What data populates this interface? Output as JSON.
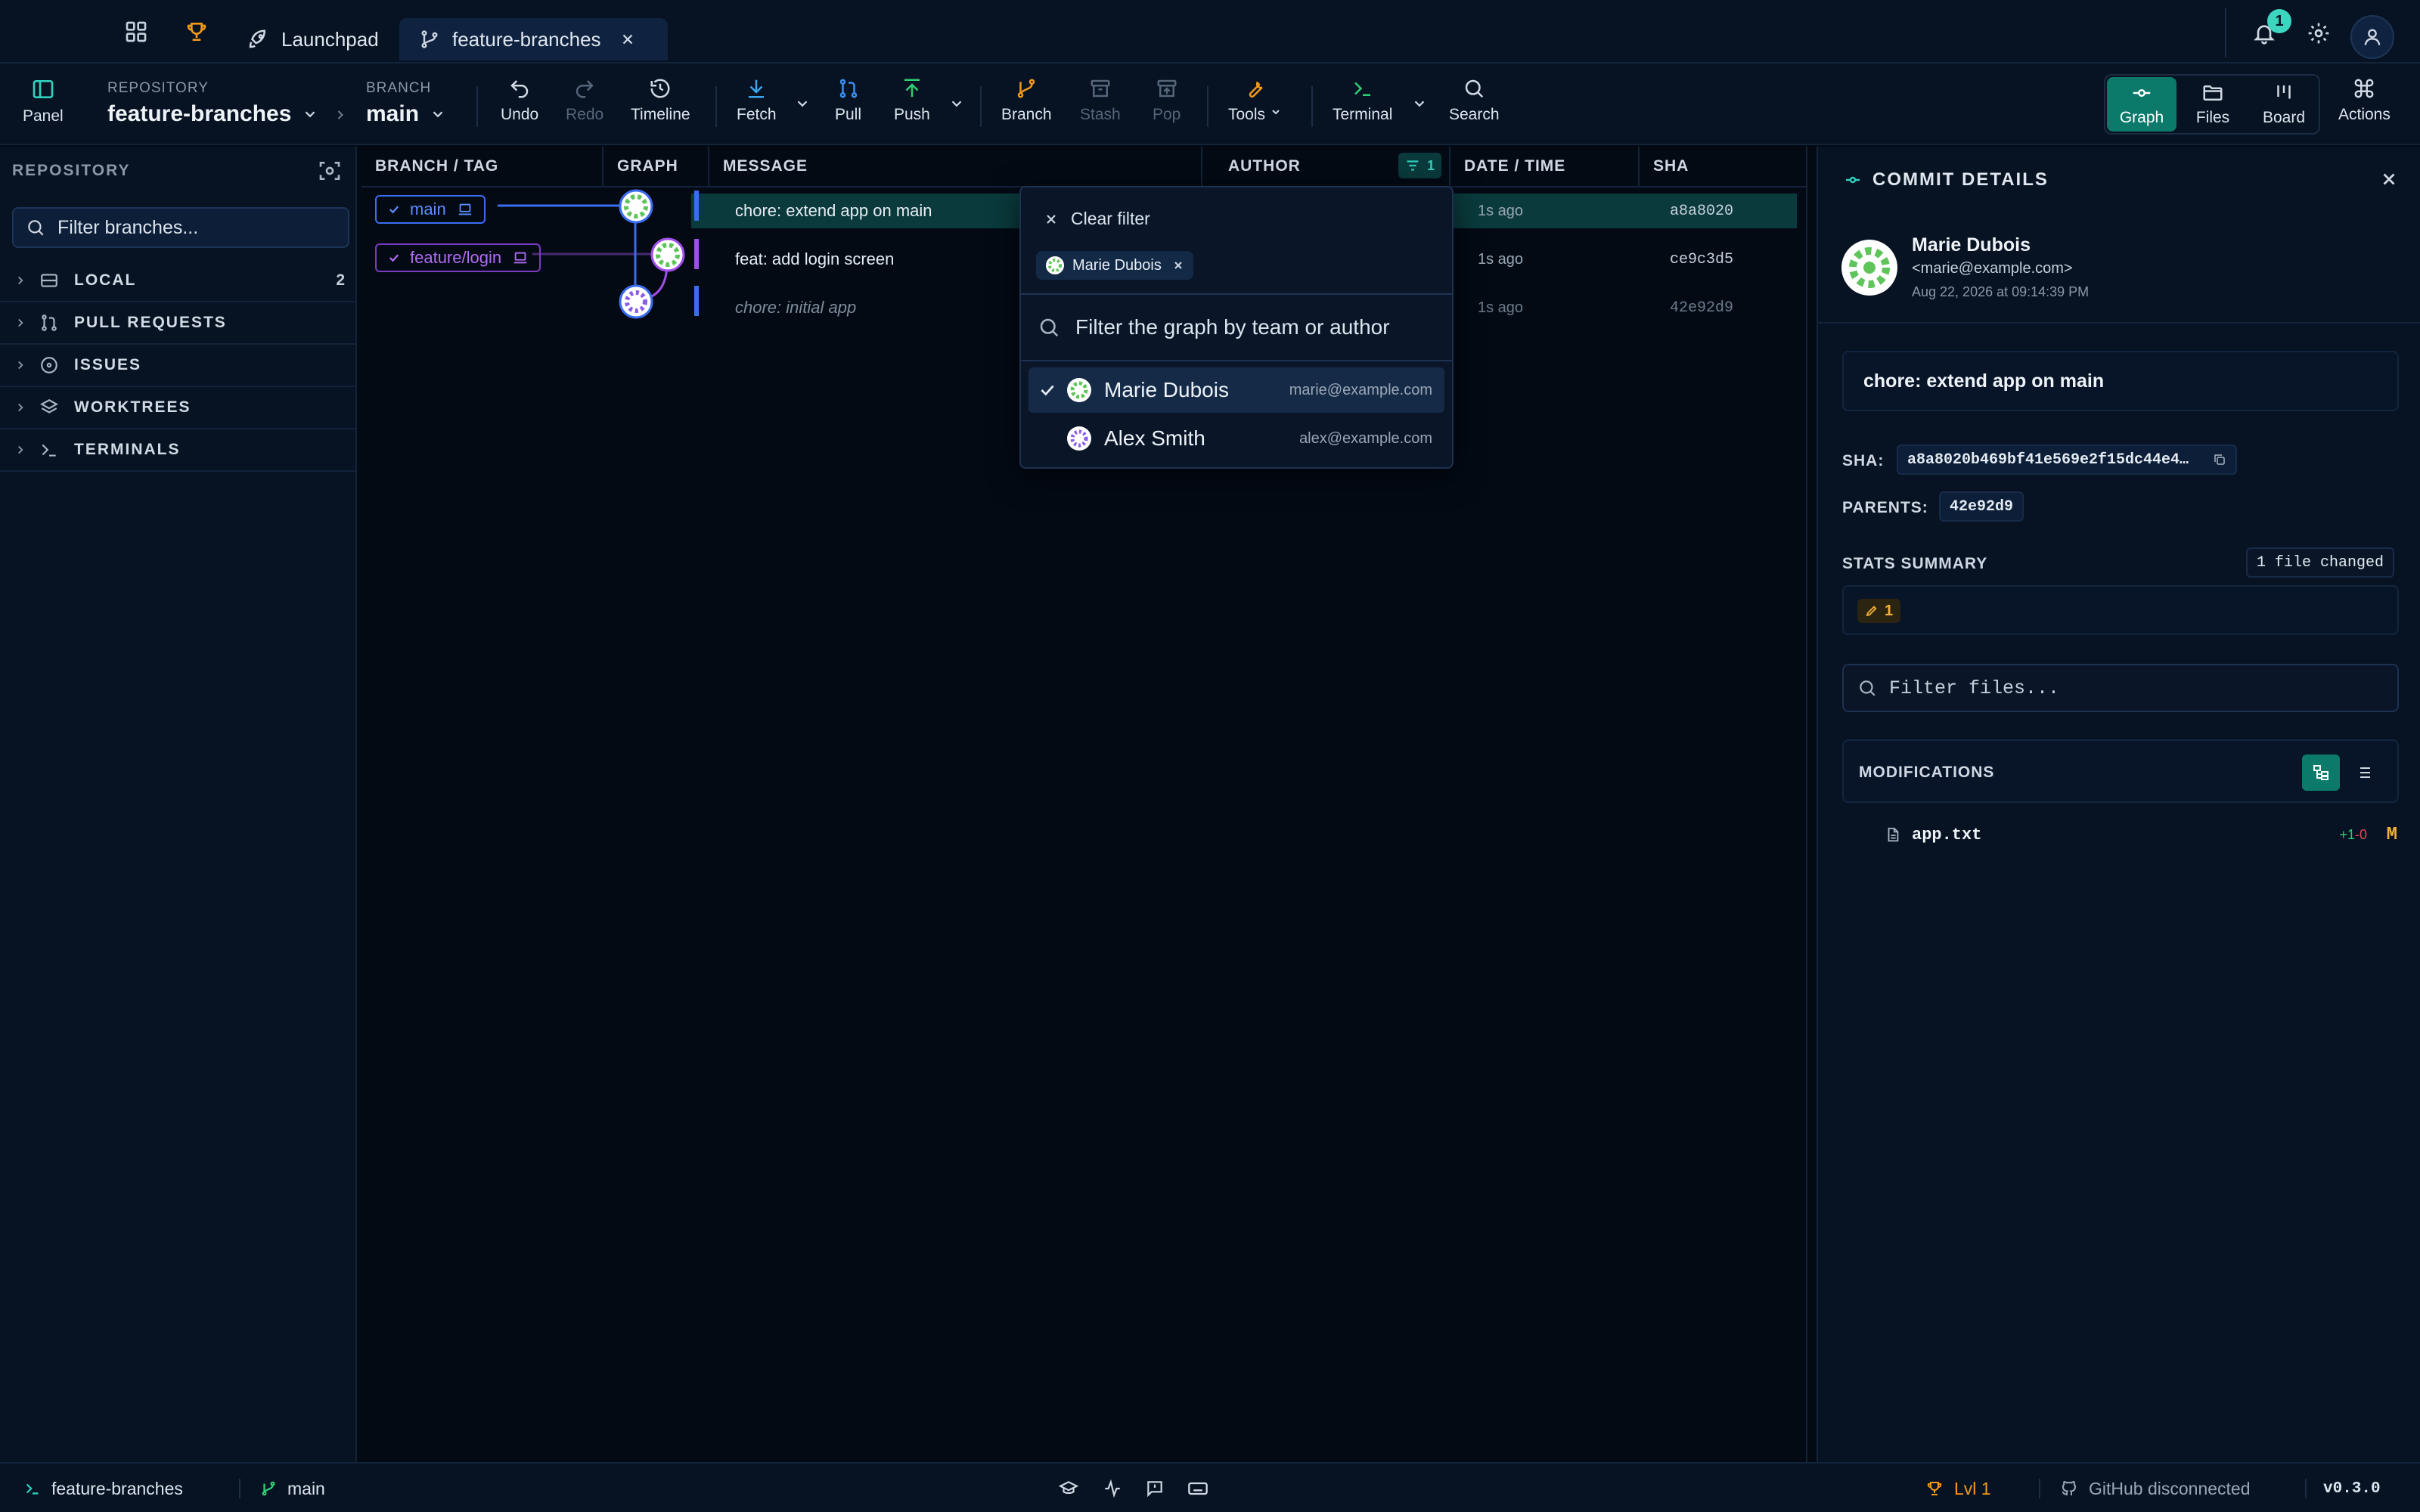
{
  "titlebar": {
    "tabs": [
      {
        "label": "Launchpad",
        "icon": "rocket-icon"
      },
      {
        "label": "feature-branches",
        "icon": "git-branch-icon",
        "active": true
      }
    ],
    "notifications_count": "1"
  },
  "toolbar": {
    "panel_label": "Panel",
    "repository_caption": "REPOSITORY",
    "repository_name": "feature-branches",
    "branch_caption": "BRANCH",
    "branch_name": "main",
    "undo": "Undo",
    "redo": "Redo",
    "timeline": "Timeline",
    "fetch": "Fetch",
    "pull": "Pull",
    "push": "Push",
    "branch": "Branch",
    "stash": "Stash",
    "pop": "Pop",
    "tools": "Tools",
    "terminal": "Terminal",
    "search": "Search",
    "views": {
      "graph": "Graph",
      "files": "Files",
      "board": "Board"
    },
    "actions": "Actions"
  },
  "sidebar": {
    "title": "REPOSITORY",
    "filter_placeholder": "Filter branches...",
    "sections": [
      {
        "label": "LOCAL",
        "icon": "drive-icon",
        "count": "2"
      },
      {
        "label": "PULL REQUESTS",
        "icon": "pull-request-icon",
        "count": ""
      },
      {
        "label": "ISSUES",
        "icon": "issue-icon",
        "count": ""
      },
      {
        "label": "WORKTREES",
        "icon": "layers-icon",
        "count": ""
      },
      {
        "label": "TERMINALS",
        "icon": "terminal-icon",
        "count": ""
      }
    ]
  },
  "graph": {
    "columns": {
      "branch_tag": "BRANCH / TAG",
      "graph": "GRAPH",
      "message": "MESSAGE",
      "author": "AUTHOR",
      "author_filter_count": "1",
      "datetime": "DATE / TIME",
      "sha": "SHA"
    },
    "commits": [
      {
        "branch": "main",
        "message": "chore: extend app on main",
        "date": "1s ago",
        "sha": "a8a8020"
      },
      {
        "branch": "feature/login",
        "message": "feat: add login screen",
        "date": "1s ago",
        "sha": "ce9c3d5"
      },
      {
        "branch": "",
        "message": "chore: initial app",
        "date": "1s ago",
        "sha": "42e92d9"
      }
    ]
  },
  "author_filter": {
    "clear_label": "Clear filter",
    "chip": "Marie Dubois",
    "search_placeholder": "Filter the graph by team or author",
    "authors": [
      {
        "name": "Marie Dubois",
        "email": "marie@example.com",
        "selected": true
      },
      {
        "name": "Alex Smith",
        "email": "alex@example.com",
        "selected": false
      }
    ]
  },
  "details": {
    "title": "COMMIT DETAILS",
    "author_name": "Marie Dubois",
    "author_email": "<marie@example.com>",
    "date": "Aug 22, 2026 at 09:14:39 PM",
    "message": "chore: extend app on main",
    "sha_label": "SHA:",
    "sha": "a8a8020b469bf41e569e2f15dc44e4…",
    "parents_label": "PARENTS:",
    "parent": "42e92d9",
    "stats_label": "STATS SUMMARY",
    "files_changed": "1 file changed",
    "modified_count": "1",
    "filter_placeholder": "Filter files...",
    "modifications_label": "MODIFICATIONS",
    "files": [
      {
        "name": "app.txt",
        "added": "+1",
        "removed": "-0",
        "status": "M"
      }
    ]
  },
  "statusbar": {
    "repo": "feature-branches",
    "branch": "main",
    "level": "Lvl 1",
    "github": "GitHub disconnected",
    "version": "v0.3.0"
  },
  "colors": {
    "accent": "#0c7a6b",
    "main_branch": "#3b6df0",
    "feature_branch": "#a04ee8",
    "modified": "#f2b233"
  }
}
